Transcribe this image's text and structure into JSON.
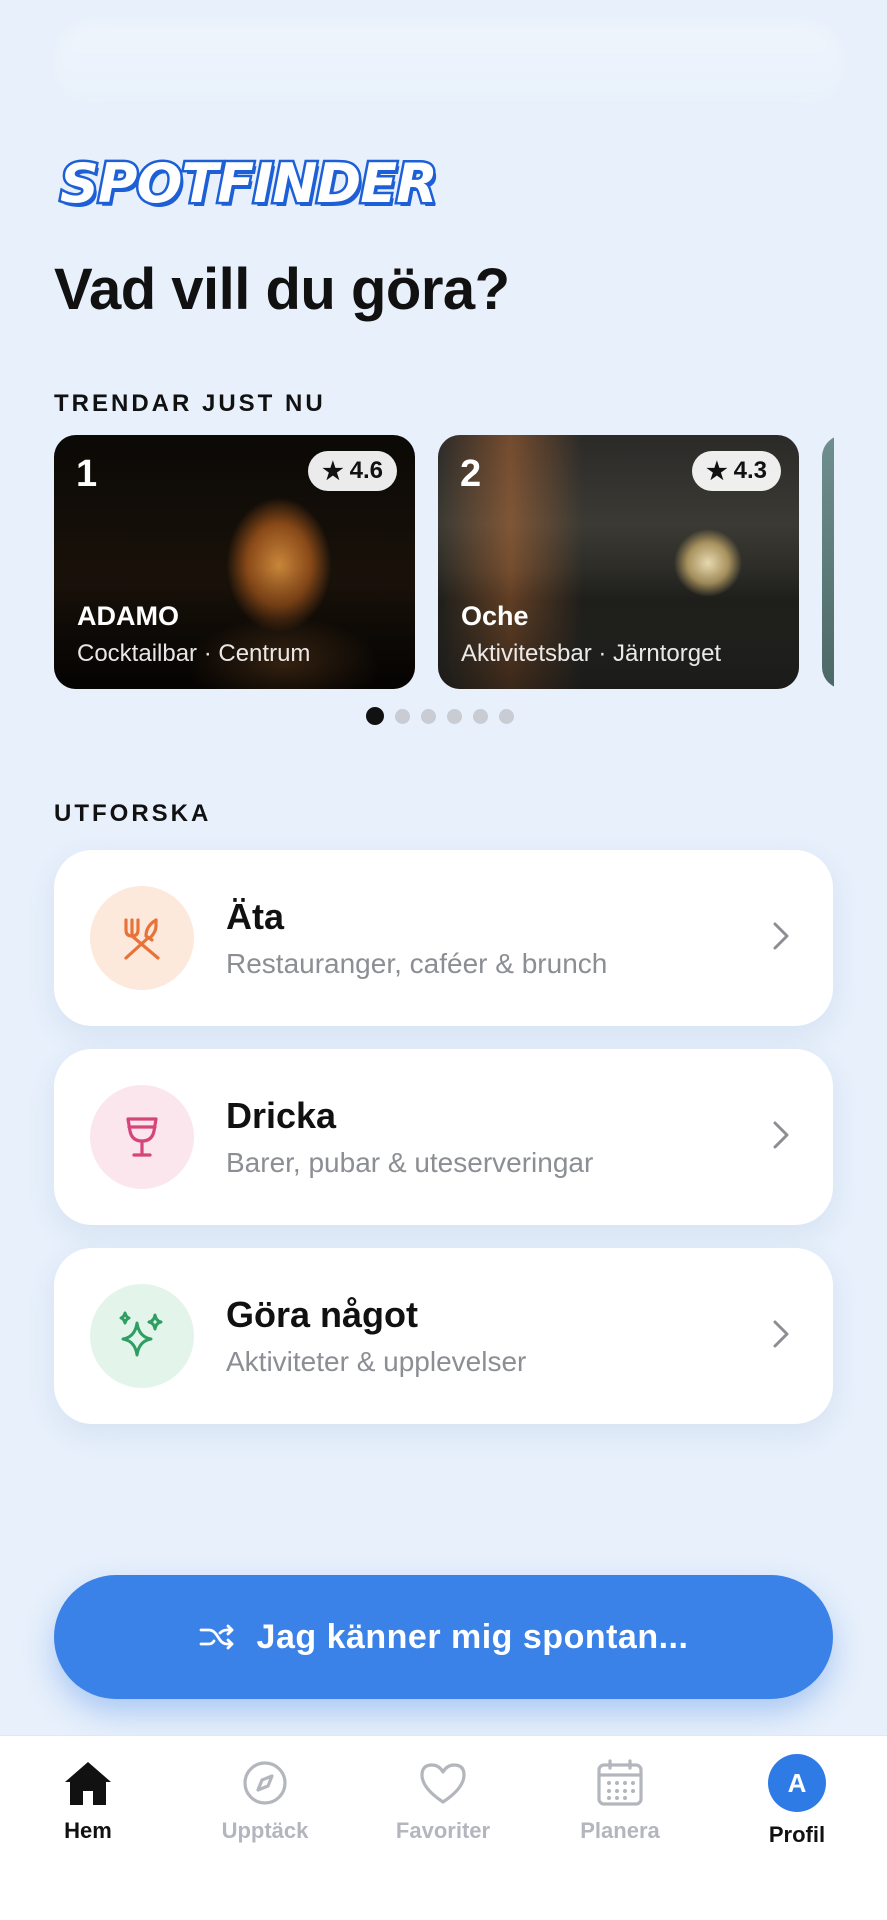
{
  "app": {
    "logo_text": "SPOTFINDER",
    "headline": "Vad vill du göra?"
  },
  "trending": {
    "label": "TRENDAR JUST NU",
    "cards": [
      {
        "rank": "1",
        "rating": "4.6",
        "title": "ADAMO",
        "subtitle": "Cocktailbar · Centrum"
      },
      {
        "rank": "2",
        "rating": "4.3",
        "title": "Oche",
        "subtitle": "Aktivitetsbar · Järntorget"
      }
    ],
    "page_count": 6,
    "active_page": 1
  },
  "explore": {
    "label": "UTFORSKA",
    "items": [
      {
        "title": "Äta",
        "subtitle": "Restauranger, caféer & brunch",
        "icon": "utensils-icon",
        "color": "#e8733a",
        "bg": "#fde9dc"
      },
      {
        "title": "Dricka",
        "subtitle": "Barer, pubar & uteserveringar",
        "icon": "wine-glass-icon",
        "color": "#d6457a",
        "bg": "#fce6ee"
      },
      {
        "title": "Göra något",
        "subtitle": "Aktiviteter & upplevelser",
        "icon": "sparkles-icon",
        "color": "#2e9e63",
        "bg": "#e3f5ea"
      }
    ]
  },
  "spontan_button": {
    "label": "Jag känner mig spontan...",
    "icon": "shuffle-icon",
    "color": "#3b82e8"
  },
  "tabbar": {
    "tabs": [
      {
        "label": "Hem",
        "icon": "home-icon",
        "active": true
      },
      {
        "label": "Upptäck",
        "icon": "compass-icon",
        "active": false
      },
      {
        "label": "Favoriter",
        "icon": "heart-icon",
        "active": false
      },
      {
        "label": "Planera",
        "icon": "calendar-icon",
        "active": false
      },
      {
        "label": "Profil",
        "icon": "avatar-icon",
        "avatar_initial": "A",
        "active": false
      }
    ]
  }
}
